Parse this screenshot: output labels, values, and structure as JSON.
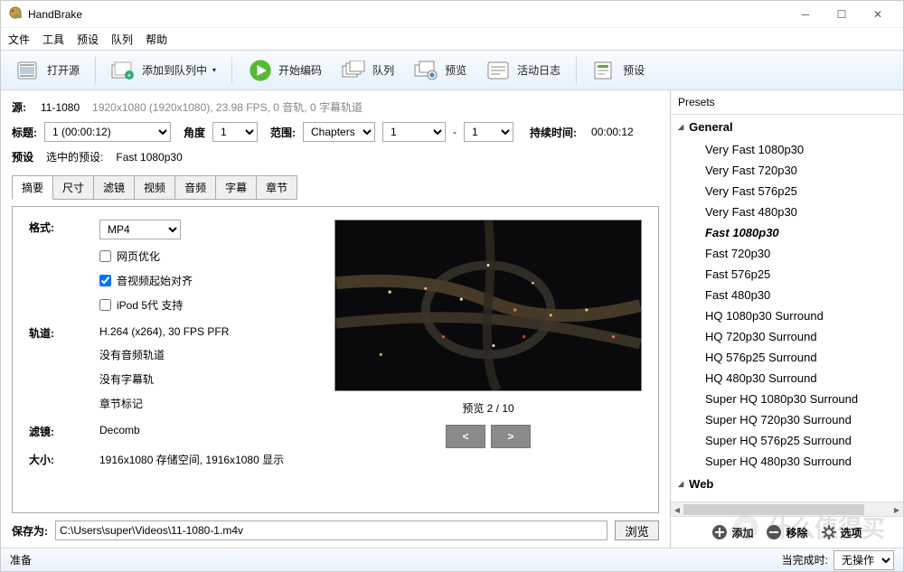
{
  "titlebar": {
    "title": "HandBrake"
  },
  "menu": [
    "文件",
    "工具",
    "预设",
    "队列",
    "帮助"
  ],
  "toolbar": {
    "open": "打开源",
    "add_queue": "添加到队列中",
    "start": "开始编码",
    "queue": "队列",
    "preview": "预览",
    "log": "活动日志",
    "presets": "预设"
  },
  "source": {
    "label": "源:",
    "name": "11-1080",
    "info": "1920x1080 (1920x1080), 23.98 FPS, 0 音轨, 0 字幕轨道"
  },
  "picker": {
    "title_label": "标题:",
    "title": "1 (00:00:12)",
    "angle_label": "角度",
    "angle": "1",
    "range_label": "范围:",
    "range_type": "Chapters",
    "from": "1",
    "to": "1",
    "dash": "-",
    "duration_label": "持续时间:",
    "duration": "00:00:12"
  },
  "preset": {
    "label": "预设",
    "text": "选中的预设:",
    "name": "Fast 1080p30"
  },
  "tabs": [
    "摘要",
    "尺寸",
    "滤镜",
    "视频",
    "音频",
    "字幕",
    "章节"
  ],
  "summary": {
    "format_label": "格式:",
    "format": "MP4",
    "chk_web": "网页优化",
    "chk_av": "音视频起始对齐",
    "chk_ipod": "iPod 5代 支持",
    "tracks_label": "轨道:",
    "track_video": "H.264 (x264), 30 FPS PFR",
    "track_audio": "没有音频轨道",
    "track_sub": "没有字幕轨",
    "track_chap": "章节标记",
    "filter_label": "滤镜:",
    "filter": "Decomb",
    "size_label": "大小:",
    "size": "1916x1080 存储空间, 1916x1080 显示"
  },
  "preview": {
    "counter": "预览 2 / 10",
    "prev": "<",
    "next": ">"
  },
  "save": {
    "label": "保存为:",
    "path": "C:\\Users\\super\\Videos\\11-1080-1.m4v",
    "browse": "浏览"
  },
  "sidebar": {
    "head": "Presets",
    "groups": [
      {
        "name": "General",
        "items": [
          "Very Fast 1080p30",
          "Very Fast 720p30",
          "Very Fast 576p25",
          "Very Fast 480p30",
          "Fast 1080p30",
          "Fast 720p30",
          "Fast 576p25",
          "Fast 480p30",
          "HQ 1080p30 Surround",
          "HQ 720p30 Surround",
          "HQ 576p25 Surround",
          "HQ 480p30 Surround",
          "Super HQ 1080p30 Surround",
          "Super HQ 720p30 Surround",
          "Super HQ 576p25 Surround",
          "Super HQ 480p30 Surround"
        ],
        "selected": "Fast 1080p30"
      },
      {
        "name": "Web",
        "items": []
      }
    ],
    "add": "添加",
    "remove": "移除",
    "options": "选项"
  },
  "status": {
    "left": "准备",
    "right_label": "当完成时:",
    "right_value": "无操作"
  },
  "watermark": "什么值得买"
}
